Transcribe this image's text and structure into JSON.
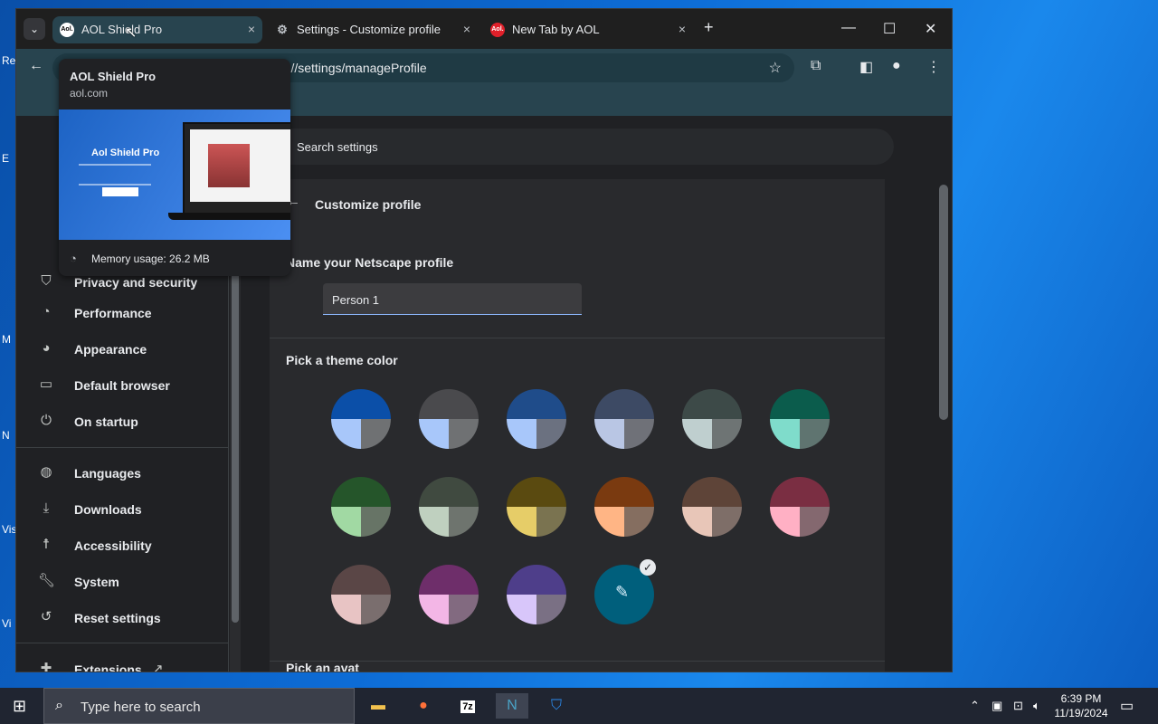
{
  "desktop": {
    "icon_labels": [
      "Re",
      "E",
      "M",
      "N",
      "Vis",
      "Vi"
    ]
  },
  "browser": {
    "tabs": [
      {
        "favicon": "Aol.",
        "title": "AOL Shield Pro",
        "close": "×"
      },
      {
        "favicon": "gear-icon",
        "title": "Settings - Customize profile",
        "close": "×"
      },
      {
        "favicon": "Aol.",
        "title": "New Tab by AOL",
        "close": "×"
      }
    ],
    "new_tab": "+",
    "window_controls": {
      "minimize": "—",
      "maximize": "☐",
      "close": "✕"
    },
    "url_partial": "ne://settings/manageProfile",
    "search_placeholder": "Search settings"
  },
  "hover_card": {
    "title": "AOL Shield Pro",
    "domain": "aol.com",
    "preview_brand": "Aol Shield Pro",
    "memory": "Memory usage: 26.2 MB"
  },
  "sidebar": {
    "items": [
      {
        "label": "Privacy and security",
        "icon": "shield-icon"
      },
      {
        "label": "Performance",
        "icon": "gauge-icon"
      },
      {
        "label": "Appearance",
        "icon": "palette-icon"
      },
      {
        "label": "Default browser",
        "icon": "browser-icon"
      },
      {
        "label": "On startup",
        "icon": "power-icon"
      },
      {
        "label": "Languages",
        "icon": "globe-icon"
      },
      {
        "label": "Downloads",
        "icon": "download-icon"
      },
      {
        "label": "Accessibility",
        "icon": "accessibility-icon"
      },
      {
        "label": "System",
        "icon": "wrench-icon"
      },
      {
        "label": "Reset settings",
        "icon": "history-icon"
      },
      {
        "label": "Extensions",
        "icon": "puzzle-icon"
      }
    ]
  },
  "page": {
    "title": "Customize profile",
    "name_label": "Name your Netscape profile",
    "name_value": "Person 1",
    "theme_label": "Pick a theme color",
    "next_section_partial": "Pick an avat"
  },
  "theme_colors": [
    {
      "top": "#0b4fa8",
      "bl": "#a8c7fa",
      "br": "#6f7173"
    },
    {
      "top": "#4a4a4d",
      "bl": "#a8c7fa",
      "br": "#6f7173"
    },
    {
      "top": "#1f4c8a",
      "bl": "#a8c7fa",
      "br": "#6b7180"
    },
    {
      "top": "#3d4a64",
      "bl": "#b9c6e4",
      "br": "#6f7178"
    },
    {
      "top": "#3d4a48",
      "bl": "#bfcfcf",
      "br": "#6e7474"
    },
    {
      "top": "#0b5c4c",
      "bl": "#7fdccb",
      "br": "#5f7470"
    },
    {
      "top": "#25552a",
      "bl": "#a1d9a3",
      "br": "#677466"
    },
    {
      "top": "#404a40",
      "bl": "#bfd0bf",
      "br": "#6e746e"
    },
    {
      "top": "#5a4a10",
      "bl": "#e6cd68",
      "br": "#7a7350"
    },
    {
      "top": "#7a3a10",
      "bl": "#ffb585",
      "br": "#856e60"
    },
    {
      "top": "#5e4438",
      "bl": "#e8c6b8",
      "br": "#7e6e68"
    },
    {
      "top": "#7a2e42",
      "bl": "#ffb0c4",
      "br": "#84686f"
    },
    {
      "top": "#5a4646",
      "bl": "#e8c4c4",
      "br": "#7a6e6e"
    },
    {
      "top": "#6e2e6a",
      "bl": "#f3b6e6",
      "br": "#826a80"
    },
    {
      "top": "#4e3e8a",
      "bl": "#d8c6fa",
      "br": "#7a7084"
    }
  ],
  "custom_color": {
    "accent": "#005f7c",
    "icon": "eyedropper-icon",
    "check": "✓"
  },
  "taskbar": {
    "search_placeholder": "Type here to search",
    "apps": [
      "file-explorer-icon",
      "firefox-icon",
      "7zip-icon",
      "netscape-icon",
      "aol-shield-icon"
    ],
    "app_7zip_label": "7z",
    "time": "6:39 PM",
    "date": "11/19/2024"
  }
}
